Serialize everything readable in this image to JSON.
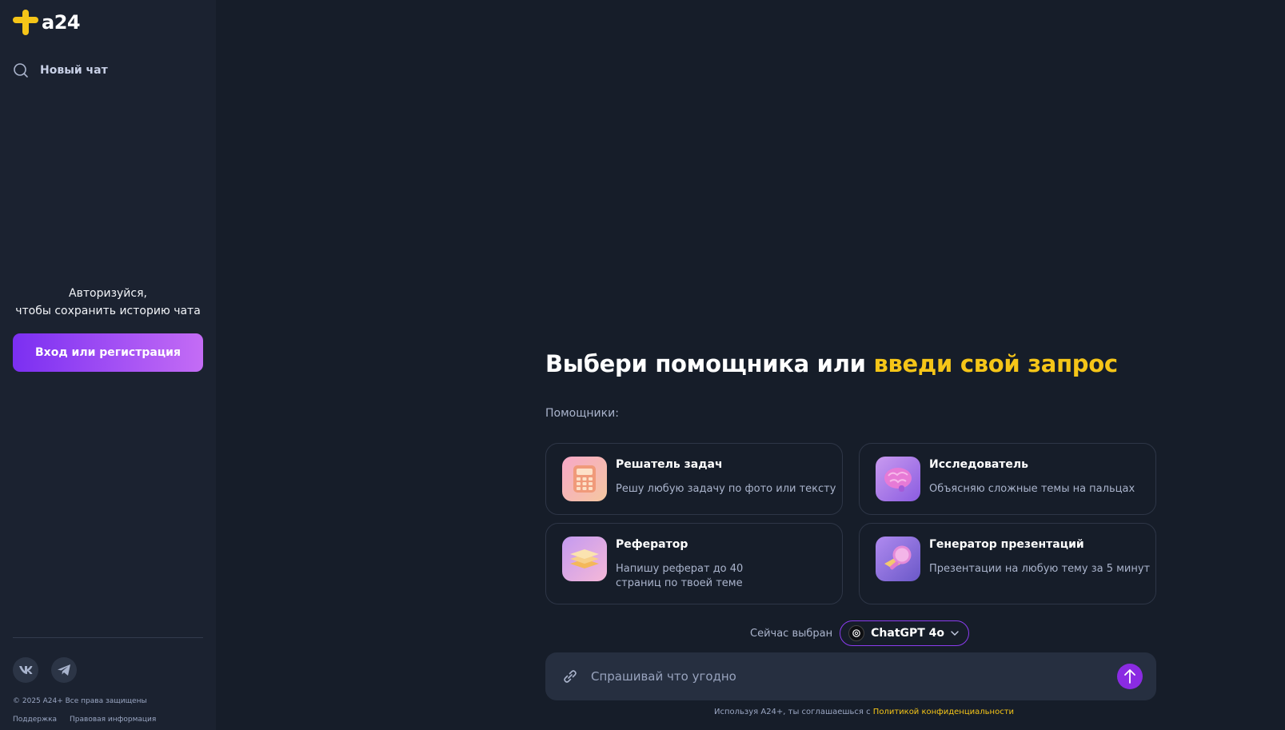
{
  "sidebar": {
    "logo_text": "a24",
    "new_chat_label": "Новый чат",
    "auth_line1": "Авторизуйся,",
    "auth_line2": "чтобы сохранить историю чата",
    "login_button": "Вход или регистрация",
    "social": [
      {
        "name": "vk-icon",
        "label": "VK"
      },
      {
        "name": "telegram-icon",
        "label": "Telegram"
      }
    ],
    "copyright": "© 2025 A24+ Все права защищены",
    "support_link": "Поддержка",
    "legal_link": "Правовая информация"
  },
  "main": {
    "title_plain": "Выбери помощника или ",
    "title_accent": "введи свой запрос",
    "helpers_label": "Помощники:",
    "helpers": [
      {
        "title": "Решатель задач",
        "desc": "Решу любую задачу по фото или тексту"
      },
      {
        "title": "Исследователь",
        "desc": "Объясняю сложные темы на пальцах"
      },
      {
        "title": "Рефератор",
        "desc_line1": "Напишу реферат до 40",
        "desc_line2": "страниц по твоей теме"
      },
      {
        "title": "Генератор презентаций",
        "desc": "Презентации на любую тему за 5 минут"
      }
    ],
    "model_label": "Сейчас выбран",
    "model_name": "ChatGPT 4o",
    "input_placeholder": "Спрашивай что угодно",
    "input_value": "",
    "disclaimer_prefix": "Используя A24+, ты соглашаешься с ",
    "disclaimer_link": "Политикой конфиденциальности"
  },
  "colors": {
    "background": "#161d29",
    "sidebar": "#1b2230",
    "accent_yellow": "#f5c518",
    "accent_purple": "#8a2be2"
  }
}
